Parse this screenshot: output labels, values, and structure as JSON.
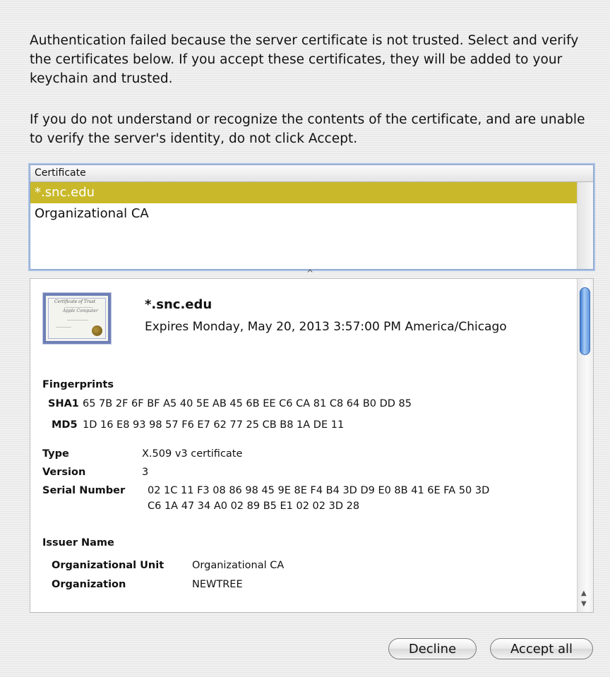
{
  "message": {
    "paragraph1": "Authentication failed because the server certificate is not trusted.  Select and verify the certificates below. If you accept these certificates, they will be added to your keychain and trusted.",
    "paragraph2": "If you do not understand or recognize the contents of the certificate, and are unable to verify the server's identity, do not click Accept."
  },
  "certificate_list": {
    "header": "Certificate",
    "items": [
      {
        "label": "*.snc.edu",
        "selected": true
      },
      {
        "label": "Organizational CA",
        "selected": false
      }
    ],
    "selection_color": "#c9b92a"
  },
  "detail": {
    "icon": "certificate-icon",
    "name": "*.snc.edu",
    "expires": "Expires Monday, May 20, 2013 3:57:00 PM America/Chicago",
    "fingerprints_label": "Fingerprints",
    "sha1_label": "SHA1",
    "sha1_value": "65 7B 2F 6F BF A5 40 5E AB 45 6B EE C6 CA 81 C8 64 B0 DD 85",
    "md5_label": "MD5",
    "md5_value": "1D 16 E8 93 98 57 F6 E7 62 77 25 CB B8 1A DE 11",
    "type_label": "Type",
    "type_value": "X.509 v3 certificate",
    "version_label": "Version",
    "version_value": "3",
    "serial_label": "Serial Number",
    "serial_line1": "02 1C 11 F3 08 86 98 45 9E 8E F4 B4 3D D9 E0 8B 41 6E FA 50 3D",
    "serial_line2": "C6 1A 47 34 A0 02 89 B5 E1 02 02 3D 28",
    "issuer_label": "Issuer Name",
    "org_unit_label": "Organizational Unit",
    "org_unit_value": "Organizational CA",
    "org_label": "Organization",
    "org_value": "NEWTREE"
  },
  "buttons": {
    "decline": "Decline",
    "accept_all": "Accept all"
  },
  "colors": {
    "scroll_thumb": "#5f95dc",
    "focus_ring": "#a9c1e3"
  }
}
